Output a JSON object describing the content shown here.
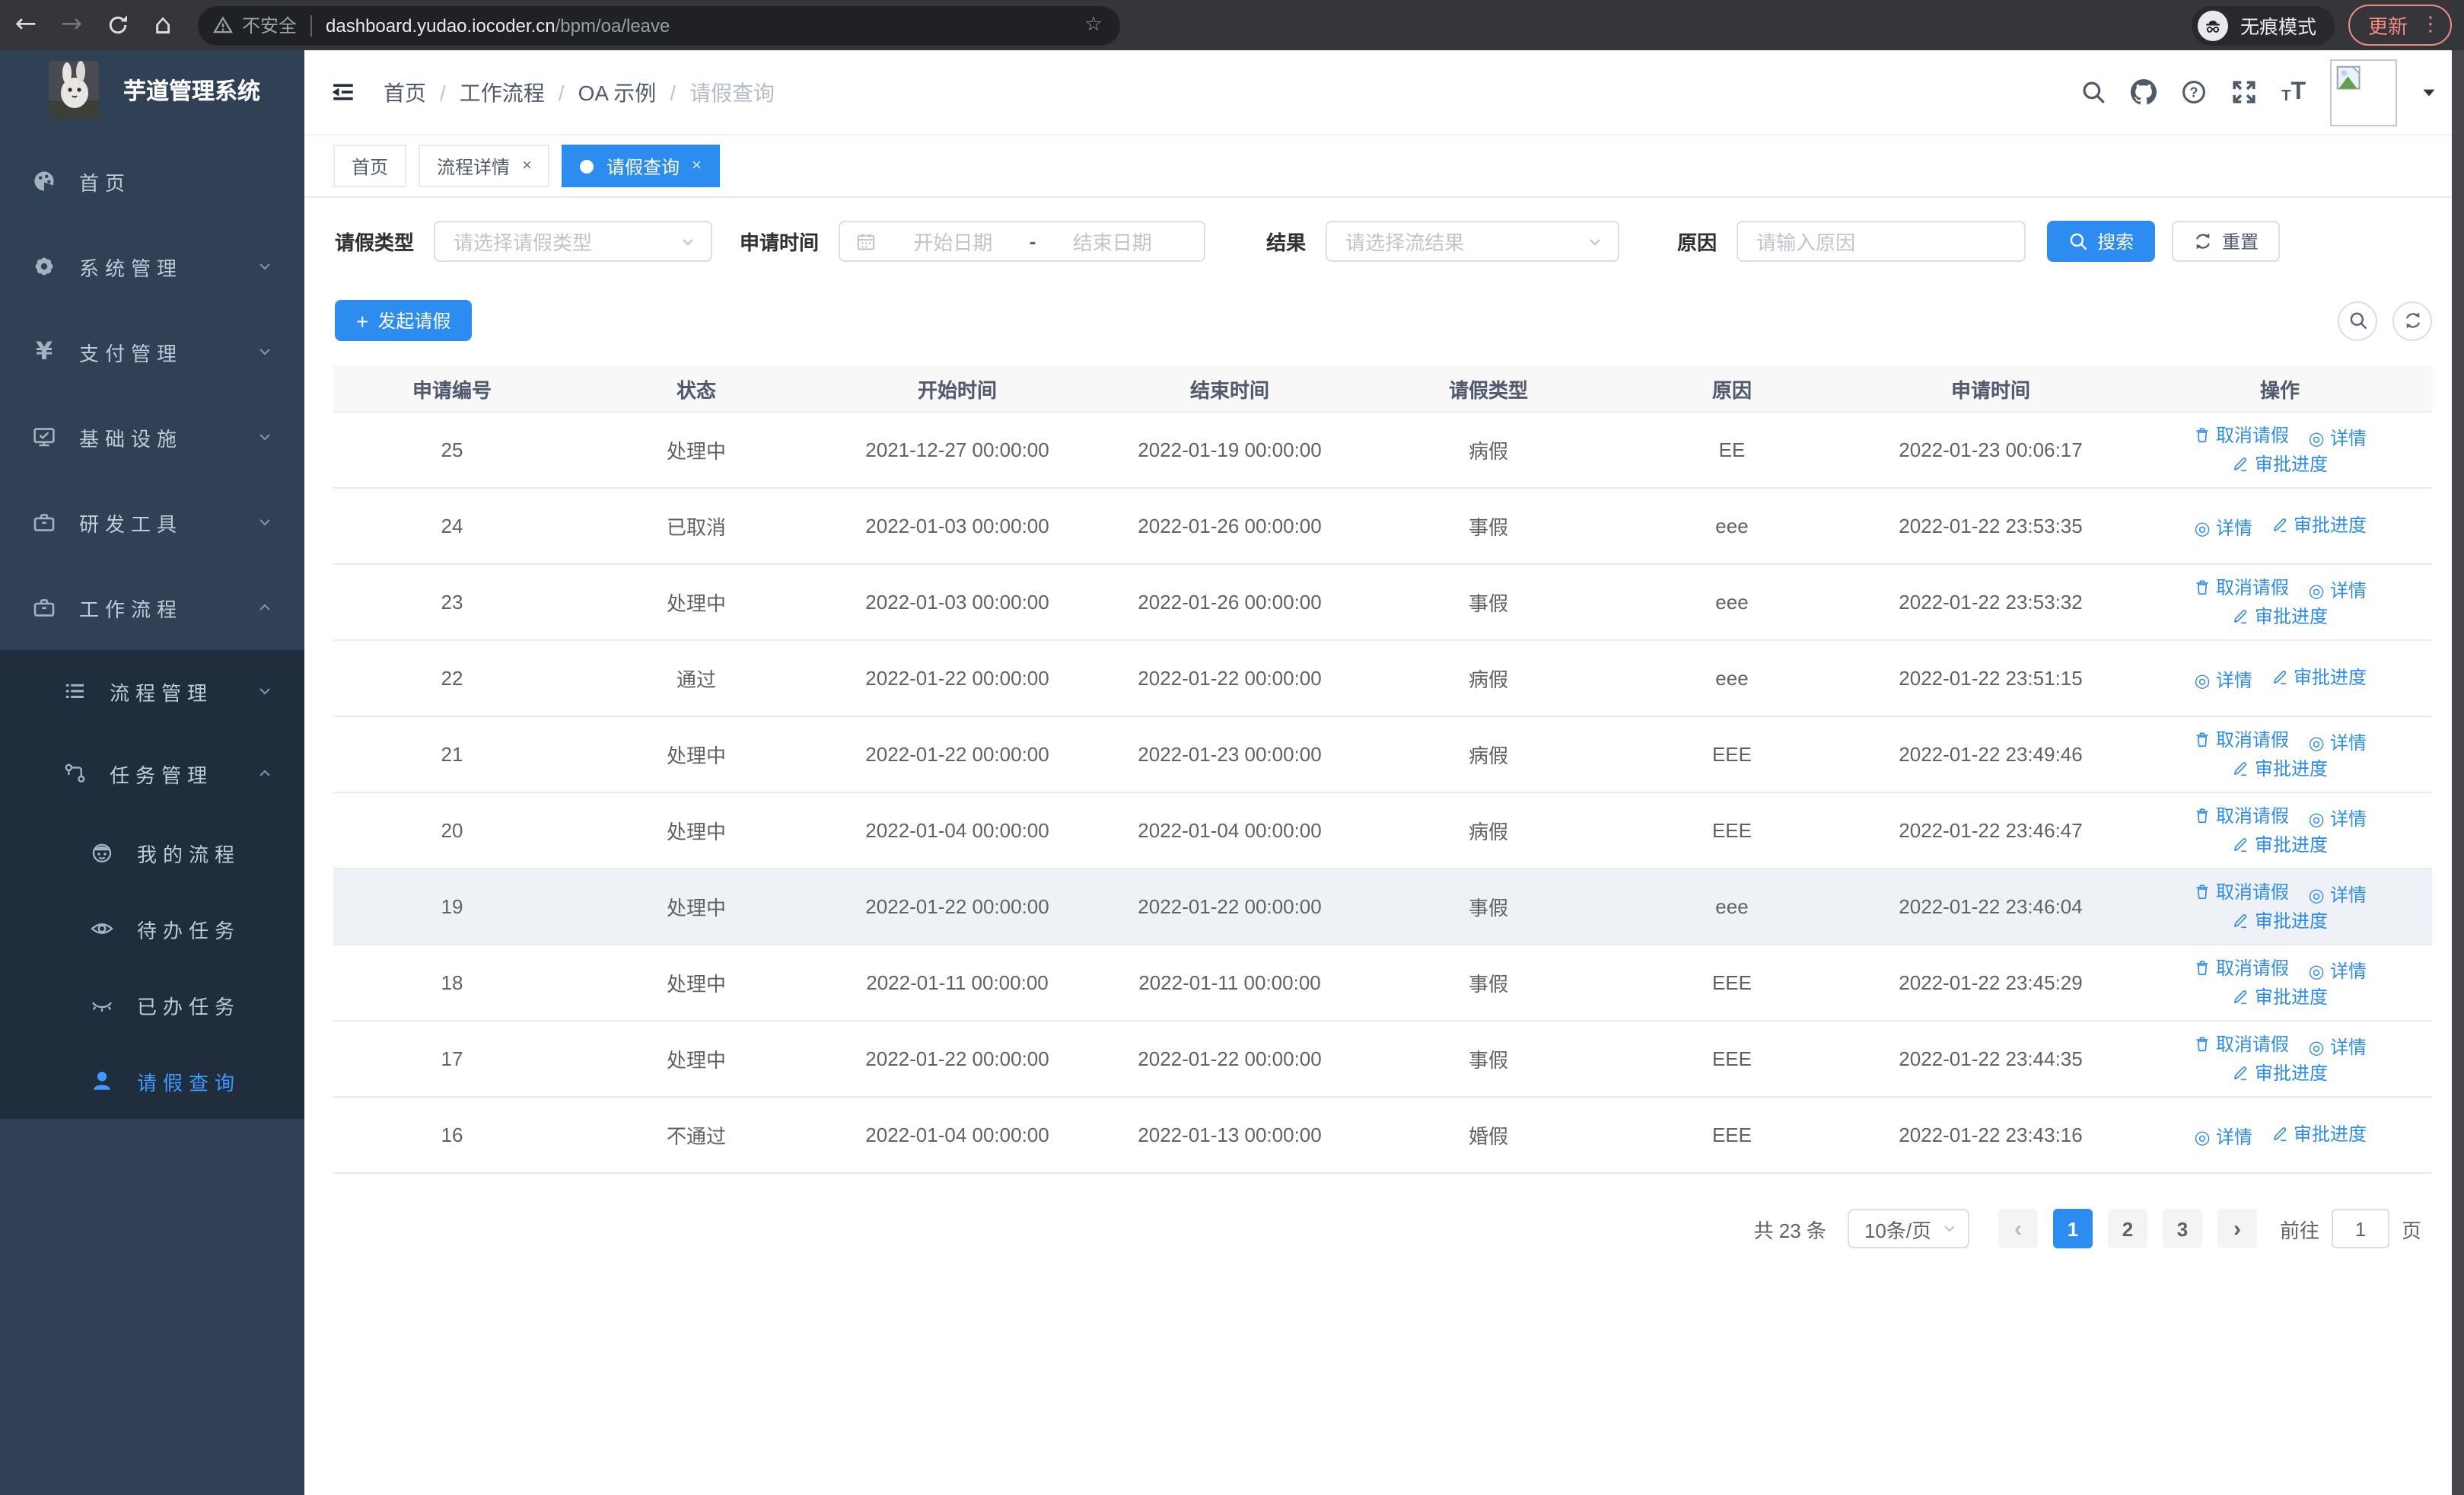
{
  "browser": {
    "security_label": "不安全",
    "url_host": "dashboard.yudao.iocoder.cn",
    "url_path": "/bpm/oa/leave",
    "incognito_label": "无痕模式",
    "update_label": "更新"
  },
  "sidebar": {
    "logo_title": "芋道管理系统",
    "items": [
      {
        "key": "home",
        "label": "首页",
        "icon": "dashboard-icon",
        "chevron": null,
        "active": false
      },
      {
        "key": "system",
        "label": "系统管理",
        "icon": "gear-icon",
        "chevron": "down",
        "active": false
      },
      {
        "key": "payment",
        "label": "支付管理",
        "icon": "yen-icon",
        "chevron": "down",
        "active": false
      },
      {
        "key": "infra",
        "label": "基础设施",
        "icon": "monitor-icon",
        "chevron": "down",
        "active": false
      },
      {
        "key": "devtools",
        "label": "研发工具",
        "icon": "toolbox-icon",
        "chevron": "down",
        "active": false
      },
      {
        "key": "workflow",
        "label": "工作流程",
        "icon": "toolbox-icon",
        "chevron": "up",
        "active": false
      }
    ],
    "submenu": [
      {
        "key": "process-mgmt",
        "label": "流程管理",
        "icon": "list-icon",
        "chevron": "down",
        "level": 2,
        "active": false
      },
      {
        "key": "task-mgmt",
        "label": "任务管理",
        "icon": "flow-icon",
        "chevron": "up",
        "level": 2,
        "active": false
      },
      {
        "key": "my-process",
        "label": "我的流程",
        "icon": "face-icon",
        "chevron": null,
        "level": 3,
        "active": false
      },
      {
        "key": "todo-task",
        "label": "待办任务",
        "icon": "eye-icon",
        "chevron": null,
        "level": 3,
        "active": false
      },
      {
        "key": "done-task",
        "label": "已办任务",
        "icon": "eye-closed-icon",
        "chevron": null,
        "level": 3,
        "active": false
      },
      {
        "key": "leave-query",
        "label": "请假查询",
        "icon": "user-icon",
        "chevron": null,
        "level": 3,
        "active": true
      }
    ]
  },
  "header": {
    "breadcrumb": [
      "首页",
      "工作流程",
      "OA 示例",
      "请假查询"
    ],
    "separator": "/"
  },
  "tabs": [
    {
      "key": "home",
      "label": "首页",
      "closable": false,
      "active": false
    },
    {
      "key": "process-detail",
      "label": "流程详情",
      "closable": true,
      "active": false
    },
    {
      "key": "leave-query",
      "label": "请假查询",
      "closable": true,
      "active": true
    }
  ],
  "filters": {
    "type_label": "请假类型",
    "type_placeholder": "请选择请假类型",
    "time_label": "申请时间",
    "date_start_placeholder": "开始日期",
    "date_separator": "-",
    "date_end_placeholder": "结束日期",
    "result_label": "结果",
    "result_placeholder": "请选择流结果",
    "reason_label": "原因",
    "reason_placeholder": "请输入原因",
    "search_label": "搜索",
    "reset_label": "重置"
  },
  "toolbar": {
    "create_label": "发起请假"
  },
  "table": {
    "columns": [
      "申请编号",
      "状态",
      "开始时间",
      "结束时间",
      "请假类型",
      "原因",
      "申请时间",
      "操作"
    ],
    "action_labels": {
      "cancel": "取消请假",
      "detail": "详情",
      "progress": "审批进度"
    },
    "rows": [
      {
        "id": "25",
        "status": "处理中",
        "start": "2021-12-27 00:00:00",
        "end": "2022-01-19 00:00:00",
        "type": "病假",
        "reason": "EE",
        "apply_time": "2022-01-23 00:06:17",
        "actions": [
          "cancel",
          "detail",
          "progress"
        ],
        "highlight": false
      },
      {
        "id": "24",
        "status": "已取消",
        "start": "2022-01-03 00:00:00",
        "end": "2022-01-26 00:00:00",
        "type": "事假",
        "reason": "eee",
        "apply_time": "2022-01-22 23:53:35",
        "actions": [
          "detail",
          "progress"
        ],
        "highlight": false
      },
      {
        "id": "23",
        "status": "处理中",
        "start": "2022-01-03 00:00:00",
        "end": "2022-01-26 00:00:00",
        "type": "事假",
        "reason": "eee",
        "apply_time": "2022-01-22 23:53:32",
        "actions": [
          "cancel",
          "detail",
          "progress"
        ],
        "highlight": false
      },
      {
        "id": "22",
        "status": "通过",
        "start": "2022-01-22 00:00:00",
        "end": "2022-01-22 00:00:00",
        "type": "病假",
        "reason": "eee",
        "apply_time": "2022-01-22 23:51:15",
        "actions": [
          "detail",
          "progress"
        ],
        "highlight": false
      },
      {
        "id": "21",
        "status": "处理中",
        "start": "2022-01-22 00:00:00",
        "end": "2022-01-23 00:00:00",
        "type": "病假",
        "reason": "EEE",
        "apply_time": "2022-01-22 23:49:46",
        "actions": [
          "cancel",
          "detail",
          "progress"
        ],
        "highlight": false
      },
      {
        "id": "20",
        "status": "处理中",
        "start": "2022-01-04 00:00:00",
        "end": "2022-01-04 00:00:00",
        "type": "病假",
        "reason": "EEE",
        "apply_time": "2022-01-22 23:46:47",
        "actions": [
          "cancel",
          "detail",
          "progress"
        ],
        "highlight": false
      },
      {
        "id": "19",
        "status": "处理中",
        "start": "2022-01-22 00:00:00",
        "end": "2022-01-22 00:00:00",
        "type": "事假",
        "reason": "eee",
        "apply_time": "2022-01-22 23:46:04",
        "actions": [
          "cancel",
          "detail",
          "progress"
        ],
        "highlight": true
      },
      {
        "id": "18",
        "status": "处理中",
        "start": "2022-01-11 00:00:00",
        "end": "2022-01-11 00:00:00",
        "type": "事假",
        "reason": "EEE",
        "apply_time": "2022-01-22 23:45:29",
        "actions": [
          "cancel",
          "detail",
          "progress"
        ],
        "highlight": false
      },
      {
        "id": "17",
        "status": "处理中",
        "start": "2022-01-22 00:00:00",
        "end": "2022-01-22 00:00:00",
        "type": "事假",
        "reason": "EEE",
        "apply_time": "2022-01-22 23:44:35",
        "actions": [
          "cancel",
          "detail",
          "progress"
        ],
        "highlight": false
      },
      {
        "id": "16",
        "status": "不通过",
        "start": "2022-01-04 00:00:00",
        "end": "2022-01-13 00:00:00",
        "type": "婚假",
        "reason": "EEE",
        "apply_time": "2022-01-22 23:43:16",
        "actions": [
          "detail",
          "progress"
        ],
        "highlight": false
      }
    ]
  },
  "pagination": {
    "total_label": "共 23 条",
    "page_size_label": "10条/页",
    "prev_symbol": "‹",
    "next_symbol": "›",
    "pages": [
      "1",
      "2",
      "3"
    ],
    "active_page": "1",
    "goto_label": "前往",
    "goto_value": "1",
    "goto_unit": "页"
  },
  "colors": {
    "primary": "#2d8cf0",
    "sidebar_bg": "#304156",
    "submenu_bg": "#1f2d3d",
    "sidebar_active": "#3d9bff",
    "chrome_bg": "#35363a",
    "update_accent": "#f28b82",
    "table_header_bg": "#f8f8f9",
    "row_highlight": "#eef1f6"
  }
}
